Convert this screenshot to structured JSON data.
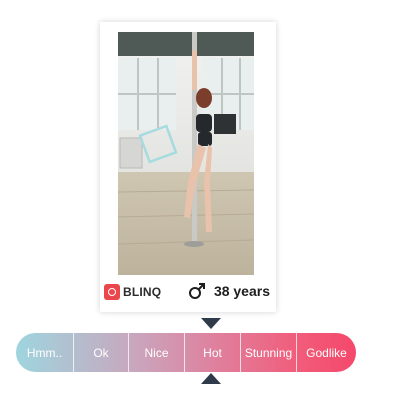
{
  "card": {
    "brand_name": "BLINQ",
    "gender": "male",
    "gender_icon": "male-symbol-icon",
    "age_text": "38 years"
  },
  "rating": {
    "options": [
      {
        "label": "Hmm.."
      },
      {
        "label": "Ok"
      },
      {
        "label": "Nice"
      },
      {
        "label": "Hot"
      },
      {
        "label": "Stunning"
      },
      {
        "label": "Godlike"
      }
    ],
    "pointer_icon": "triangle-pointer-icon",
    "colors": {
      "start": "#9ed5df",
      "end": "#f4486b",
      "pointer": "#2f3a4b"
    }
  }
}
